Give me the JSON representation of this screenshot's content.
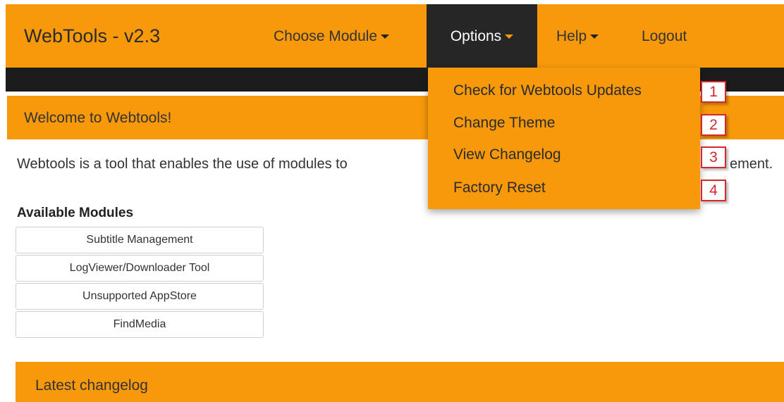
{
  "app": {
    "brand": "WebTools - v2.3"
  },
  "nav": {
    "choose_module": "Choose Module",
    "options": "Options",
    "help": "Help",
    "logout": "Logout"
  },
  "options_menu": {
    "items": [
      "Check for Webtools Updates",
      "Change Theme",
      "View Changelog",
      "Factory Reset"
    ],
    "callouts": [
      "1",
      "2",
      "3",
      "4"
    ]
  },
  "welcome": {
    "title": "Welcome to Webtools!",
    "intro": "Webtools is a tool that enables the use of modules to",
    "intro_tail": "ement."
  },
  "modules": {
    "heading": "Available Modules",
    "items": [
      "Subtitle Management",
      "LogViewer/Downloader Tool",
      "Unsupported AppStore",
      "FindMedia"
    ]
  },
  "changelog": {
    "title": "Latest changelog"
  },
  "colors": {
    "accent": "#f7990b",
    "dark": "#262626",
    "callout_red": "#d8262f"
  }
}
